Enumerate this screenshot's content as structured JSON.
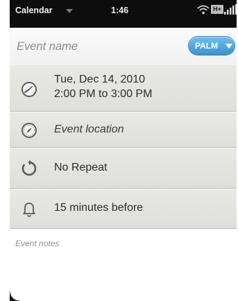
{
  "status_bar": {
    "app_name": "Calendar",
    "time": "1:46",
    "network": "H+"
  },
  "event": {
    "name_placeholder": "Event name",
    "calendar_label": "PALM"
  },
  "rows": {
    "date": "Tue, Dec 14, 2010",
    "time_range": "2:00 PM to 3:00 PM",
    "location_placeholder": "Event location",
    "repeat": "No Repeat",
    "alarm": "15 minutes before"
  },
  "notes": {
    "placeholder": "Event notes"
  },
  "colors": {
    "accent_pill": "#4aa3dc",
    "status_bar_bg": "#0d0d0d",
    "row_bg": "#e3e3df"
  }
}
